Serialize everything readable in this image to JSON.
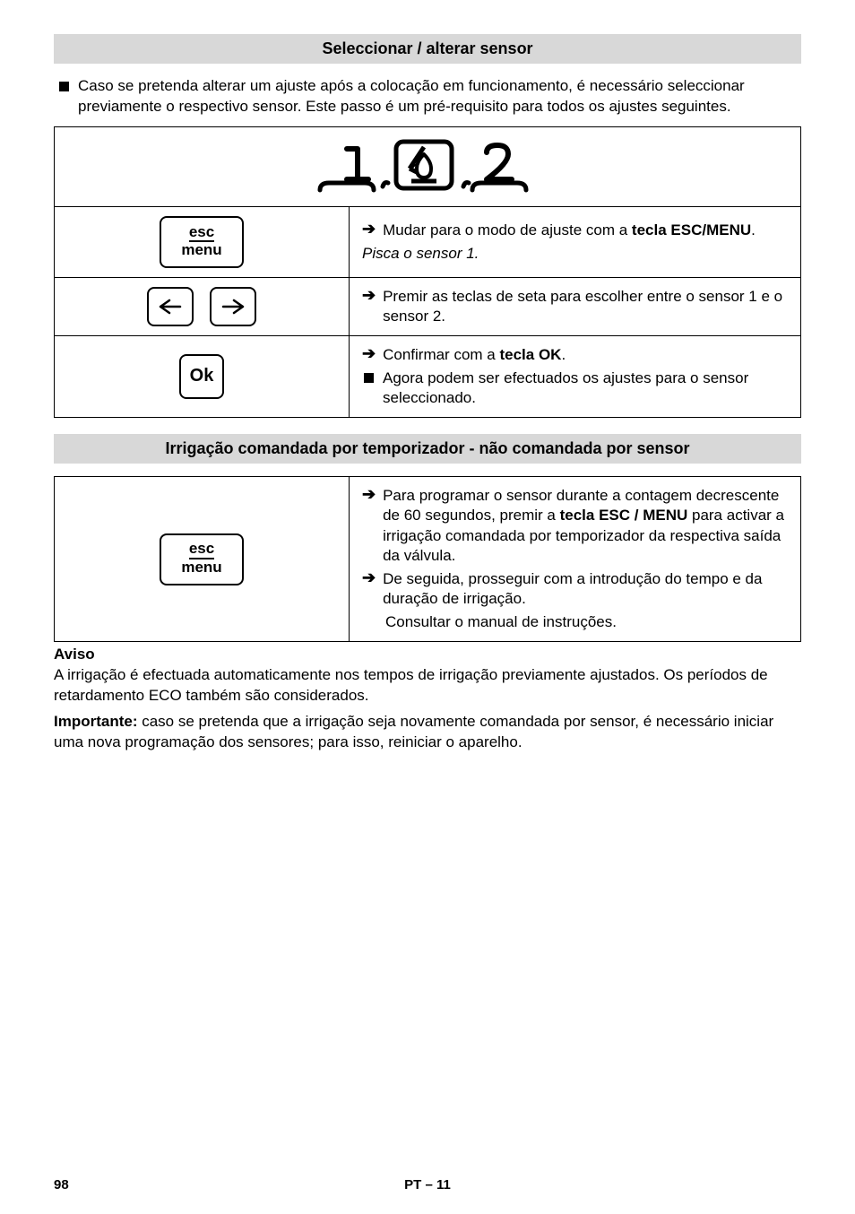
{
  "section1_title": "Seleccionar / alterar sensor",
  "intro": "Caso se pretenda alterar um ajuste após a colocação em funcionamento, é necessário seleccionar previamente o respectivo sensor. Este passo é um pré-requisito para todos os ajustes seguintes.",
  "btn_esc_top": "esc",
  "btn_esc_bot": "menu",
  "btn_ok": "Ok",
  "row2_line1a": "Mudar para o modo de ajuste com a ",
  "row2_line1b": "tecla ESC/MENU",
  "row2_line1c": ".",
  "row2_line2": "Pisca o sensor 1.",
  "row3_line": "Premir as teclas de seta para escolher entre o sensor 1 e o sensor 2.",
  "row4_line1a": "Confirmar com a ",
  "row4_line1b": "tecla OK",
  "row4_line1c": ".",
  "row4_line2": "Agora podem ser efectuados os ajustes para o sensor seleccionado.",
  "section2_title": "Irrigação comandada por temporizador - não comandada por sensor",
  "s2_line1a": "Para programar o sensor durante a contagem decrescente de 60 segundos, premir a ",
  "s2_line1b": "tecla ESC / MENU",
  "s2_line1c": " para activar a irrigação comandada por temporizador da respectiva saída da válvula.",
  "s2_line2": "De seguida, prosseguir com a introdução do tempo e da duração de irrigação.",
  "s2_line3": "Consultar o manual de instruções.",
  "aviso_title": "Aviso",
  "aviso_p1": "A irrigação é efectuada automaticamente nos tempos de irrigação previamente ajustados. Os períodos de retardamento ECO também são considerados.",
  "aviso_p2a": "Importante:",
  "aviso_p2b": " caso se pretenda que a irrigação seja novamente comandada por sensor, é necessário iniciar uma nova programação dos sensores; para isso, reiniciar o aparelho.",
  "footer_left": "98",
  "footer_center": "PT – 11"
}
